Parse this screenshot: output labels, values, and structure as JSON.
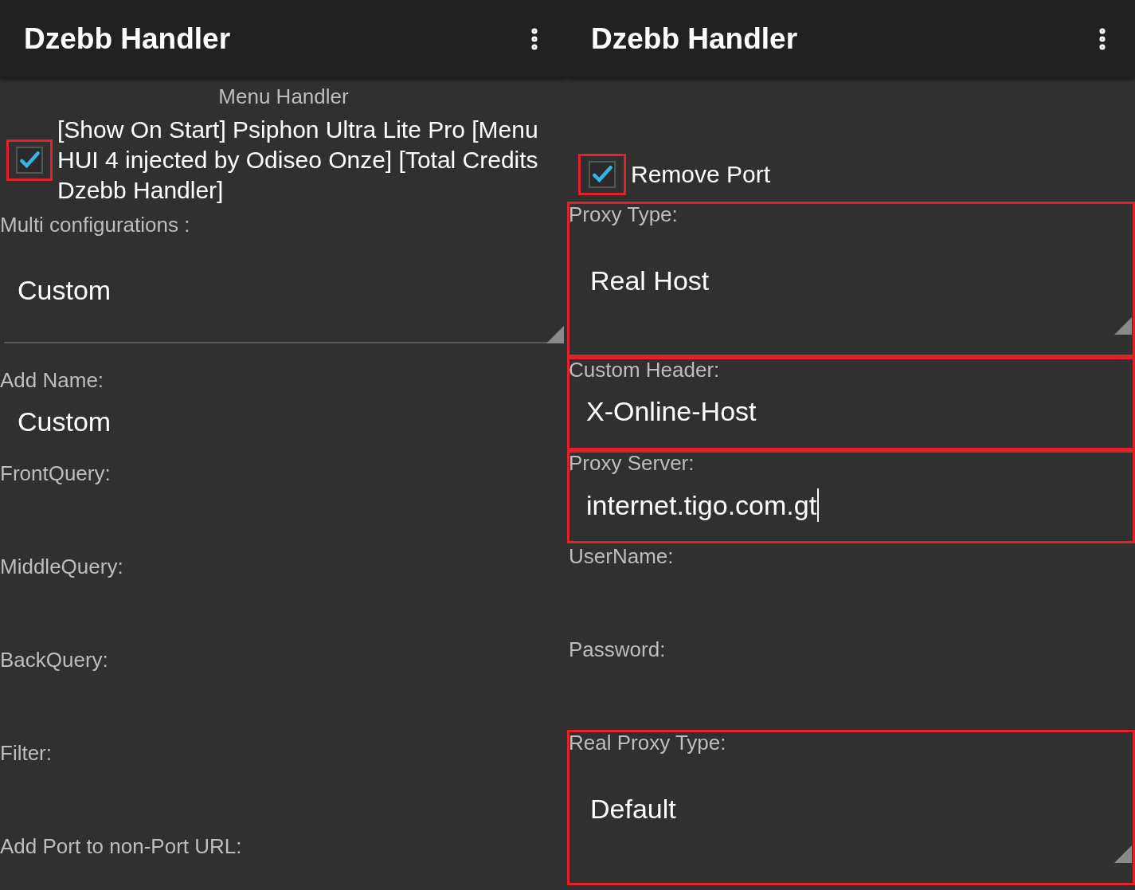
{
  "panes": [
    {
      "title": "Dzebb Handler",
      "header": "Menu Handler",
      "items": [
        {
          "kind": "checkbox",
          "label": "[Show On Start] Psiphon Ultra Lite Pro [Menu HUI 4 injected by Odiseo Onze] [Total Credits Dzebb Handler]",
          "checked": true,
          "highlighted": true
        },
        {
          "kind": "spinner",
          "label": "Multi configurations :",
          "value": "Custom",
          "highlighted": false
        },
        {
          "kind": "text",
          "label": "Add Name:",
          "value": "Custom",
          "highlighted": false,
          "focused": false
        },
        {
          "kind": "text",
          "label": "FrontQuery:",
          "highlighted": false
        },
        {
          "kind": "text",
          "label": "MiddleQuery:",
          "highlighted": false
        },
        {
          "kind": "text",
          "label": "BackQuery:",
          "highlighted": false
        },
        {
          "kind": "text",
          "label": "Filter:",
          "highlighted": false
        },
        {
          "kind": "text",
          "label": "Add Port to non-Port URL:",
          "highlighted": false
        }
      ]
    },
    {
      "title": "Dzebb Handler",
      "items": [
        {
          "kind": "checkbox",
          "label": "Remove Port",
          "checked": true,
          "highlighted": true
        },
        {
          "kind": "spinner",
          "label": "Proxy Type:",
          "value": "Real Host",
          "highlighted": true
        },
        {
          "kind": "text",
          "label": "Custom Header:",
          "value": "X-Online-Host",
          "highlighted": true,
          "focused": false
        },
        {
          "kind": "text",
          "label": "Proxy Server:",
          "value": "internet.tigo.com.gt",
          "highlighted": true,
          "focused": true
        },
        {
          "kind": "text",
          "label": "UserName:",
          "highlighted": false
        },
        {
          "kind": "text",
          "label": "Password:",
          "highlighted": false
        },
        {
          "kind": "spinner",
          "label": "Real Proxy Type:",
          "value": "Default",
          "highlighted": true
        }
      ]
    }
  ]
}
